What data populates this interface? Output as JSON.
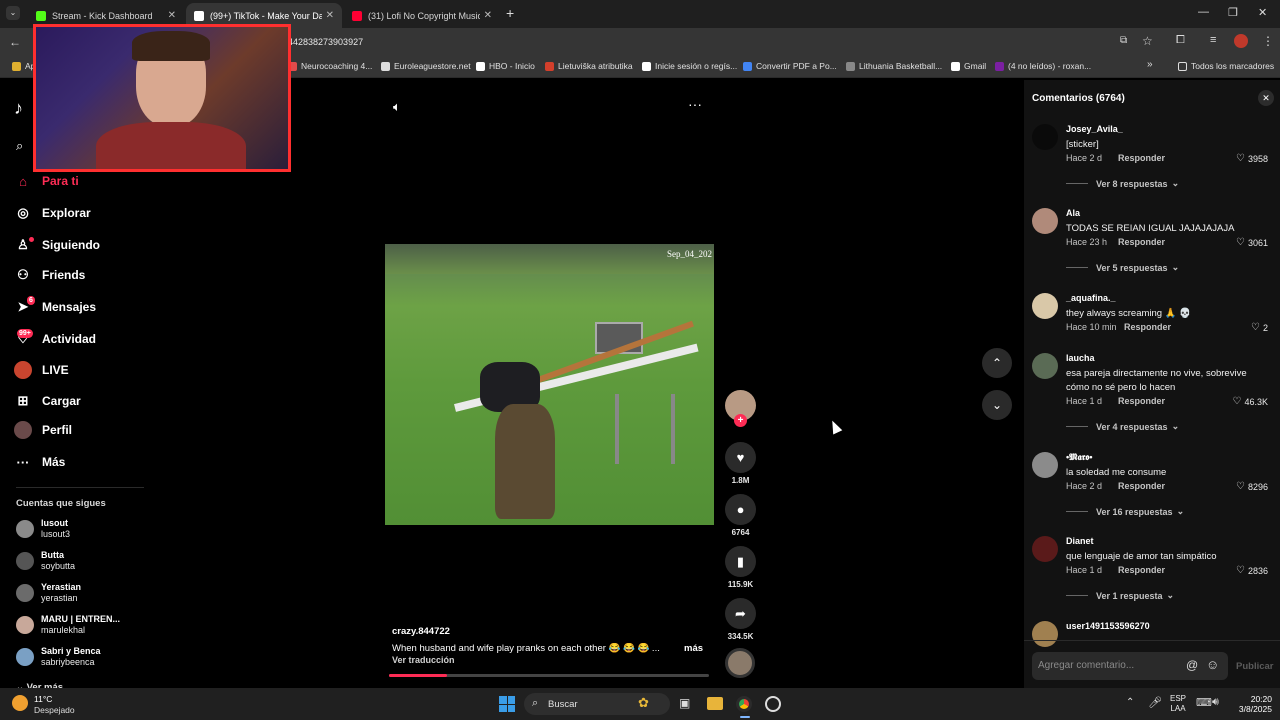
{
  "browser": {
    "tabs": [
      {
        "title": "Stream - Kick Dashboard",
        "color": "#53fc18",
        "active": false
      },
      {
        "title": "(99+) TikTok - Make Your Day",
        "color": "#ffffff",
        "active": true
      },
      {
        "title": "(31) Lofi No Copyright Music M",
        "color": "#ff0033",
        "active": false
      }
    ],
    "new_tab": "+",
    "url": "442838273903927",
    "bookmarks": [
      {
        "label": "Neurocoaching 4...",
        "color": "#e14b4b"
      },
      {
        "label": "Euroleaguestore.net",
        "color": "#dddddd"
      },
      {
        "label": "HBO - Inicio",
        "color": "#ffffff"
      },
      {
        "label": "Lietuviška atributika",
        "color": "#d33f2b"
      },
      {
        "label": "Inicie sesión o regís...",
        "color": "#ffffff"
      },
      {
        "label": "Convertir PDF a Po...",
        "color": "#4285f4"
      },
      {
        "label": "Lithuania Basketball...",
        "color": "#888888"
      },
      {
        "label": "Gmail",
        "color": "#ffffff"
      },
      {
        "label": "(4 no leídos) - roxan...",
        "color": "#7b1fa2"
      }
    ],
    "bookmarks_all": "Todos los marcadores",
    "bookmarks_apps": "Ap"
  },
  "sidebar": {
    "nav": [
      {
        "label": "Para ti",
        "icon": "home-icon",
        "glyph": "⌂",
        "active": true
      },
      {
        "label": "Explorar",
        "icon": "compass-icon",
        "glyph": "◎",
        "active": false
      },
      {
        "label": "Siguiendo",
        "icon": "following-icon",
        "glyph": "♙",
        "active": false
      },
      {
        "label": "Friends",
        "icon": "friends-icon",
        "glyph": "⚇",
        "active": false
      },
      {
        "label": "Mensajes",
        "icon": "messages-icon",
        "glyph": "➤",
        "active": false
      },
      {
        "label": "Actividad",
        "icon": "activity-icon",
        "glyph": "♡",
        "active": false
      },
      {
        "label": "LIVE",
        "icon": "live-icon",
        "glyph": "●",
        "active": false
      },
      {
        "label": "Cargar",
        "icon": "upload-icon",
        "glyph": "⊞",
        "active": false
      },
      {
        "label": "Perfil",
        "icon": "profile-icon",
        "glyph": "◉",
        "active": false
      },
      {
        "label": "Más",
        "icon": "more-icon",
        "glyph": "···",
        "active": false
      }
    ],
    "messages_badge": "6",
    "activity_badge": "99+",
    "following_title": "Cuentas que sigues",
    "following": [
      {
        "name": "lusout",
        "handle": "lusout3",
        "color": "#8a8a8a"
      },
      {
        "name": "Butta",
        "handle": "soybutta",
        "color": "#555555"
      },
      {
        "name": "Yerastian",
        "handle": "yerastian",
        "color": "#6b6b6b"
      },
      {
        "name": "MARU | ENTREN...",
        "handle": "marulekhal",
        "color": "#c8a89a"
      },
      {
        "name": "Sabri y Benca",
        "handle": "sabriybeenca",
        "color": "#7aa0c4"
      }
    ],
    "see_more": "Ver más"
  },
  "player": {
    "timestamp": "Sep_04_202",
    "author": "crazy.844722",
    "caption": "When husband and wife play pranks on each other 😂 😂 😂 ...",
    "more": "más",
    "translate": "Ver traducción",
    "progress": 0.18,
    "actions": {
      "likes": "1.8M",
      "comments": "6764",
      "saves": "115.9K",
      "shares": "334.5K"
    }
  },
  "comments": {
    "title": "Comentarios (6764)",
    "reply_label": "Responder",
    "items": [
      {
        "user": "Josey_Avila_",
        "text": "[sticker]",
        "time": "Hace 2 d",
        "likes": "3958",
        "replies": "Ver 8 respuestas",
        "color": "#0a0a0a"
      },
      {
        "user": "Ala",
        "text": "TODAS SE REIAN IGUAL JAJAJAJAJA",
        "time": "Hace 23 h",
        "likes": "3061",
        "replies": "Ver 5 respuestas",
        "color": "#b08a7a"
      },
      {
        "user": "_aquafina._",
        "text": "they always screaming 🙏 💀",
        "time": "Hace 10 min",
        "likes": "2",
        "replies": "",
        "color": "#d9c8a8"
      },
      {
        "user": "laucha",
        "text": "esa pareja directamente no vive, sobrevive cómo no sé pero lo hacen",
        "time": "Hace 1 d",
        "likes": "46.3K",
        "replies": "Ver 4 respuestas",
        "color": "#5a6b55"
      },
      {
        "user": "•𝕸𝖆𝖗𝖔•",
        "text": "la soledad me consume",
        "time": "Hace 2 d",
        "likes": "8296",
        "replies": "Ver 16 respuestas",
        "color": "#8b8b8b"
      },
      {
        "user": "Dianet",
        "text": "que lenguaje de amor tan simpático",
        "time": "Hace 1 d",
        "likes": "2836",
        "replies": "Ver 1 respuesta",
        "color": "#5a1a1a"
      },
      {
        "user": "user1491153596270",
        "text": "",
        "time": "",
        "likes": "",
        "replies": "",
        "color": "#a08050"
      }
    ],
    "input_placeholder": "Agregar comentario...",
    "publish": "Publicar"
  },
  "taskbar": {
    "weather_temp": "11°C",
    "weather_desc": "Despejado",
    "search": "Buscar",
    "lang1": "ESP",
    "lang2": "LAA",
    "time": "20:20",
    "date": "3/8/2025"
  }
}
